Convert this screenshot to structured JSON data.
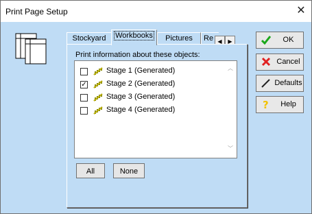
{
  "window": {
    "title": "Print Page Setup"
  },
  "tabs": [
    {
      "label": "Stockyard"
    },
    {
      "label": "Workbooks"
    },
    {
      "label": "Pictures"
    },
    {
      "label": "Re"
    }
  ],
  "panel": {
    "label": "Print information about these objects:",
    "items": [
      {
        "label": "Stage 1 (Generated)",
        "checked": false
      },
      {
        "label": "Stage 2 (Generated)",
        "checked": true
      },
      {
        "label": "Stage 3 (Generated)",
        "checked": false
      },
      {
        "label": "Stage 4 (Generated)",
        "checked": false
      }
    ],
    "all_label": "All",
    "none_label": "None"
  },
  "buttons": {
    "ok": "OK",
    "cancel": "Cancel",
    "defaults": "Defaults",
    "help": "Help"
  },
  "colors": {
    "background": "#bfdcf5",
    "ok_check": "#1aa71a",
    "cancel_x": "#e02020",
    "help_q": "#f2c200"
  }
}
